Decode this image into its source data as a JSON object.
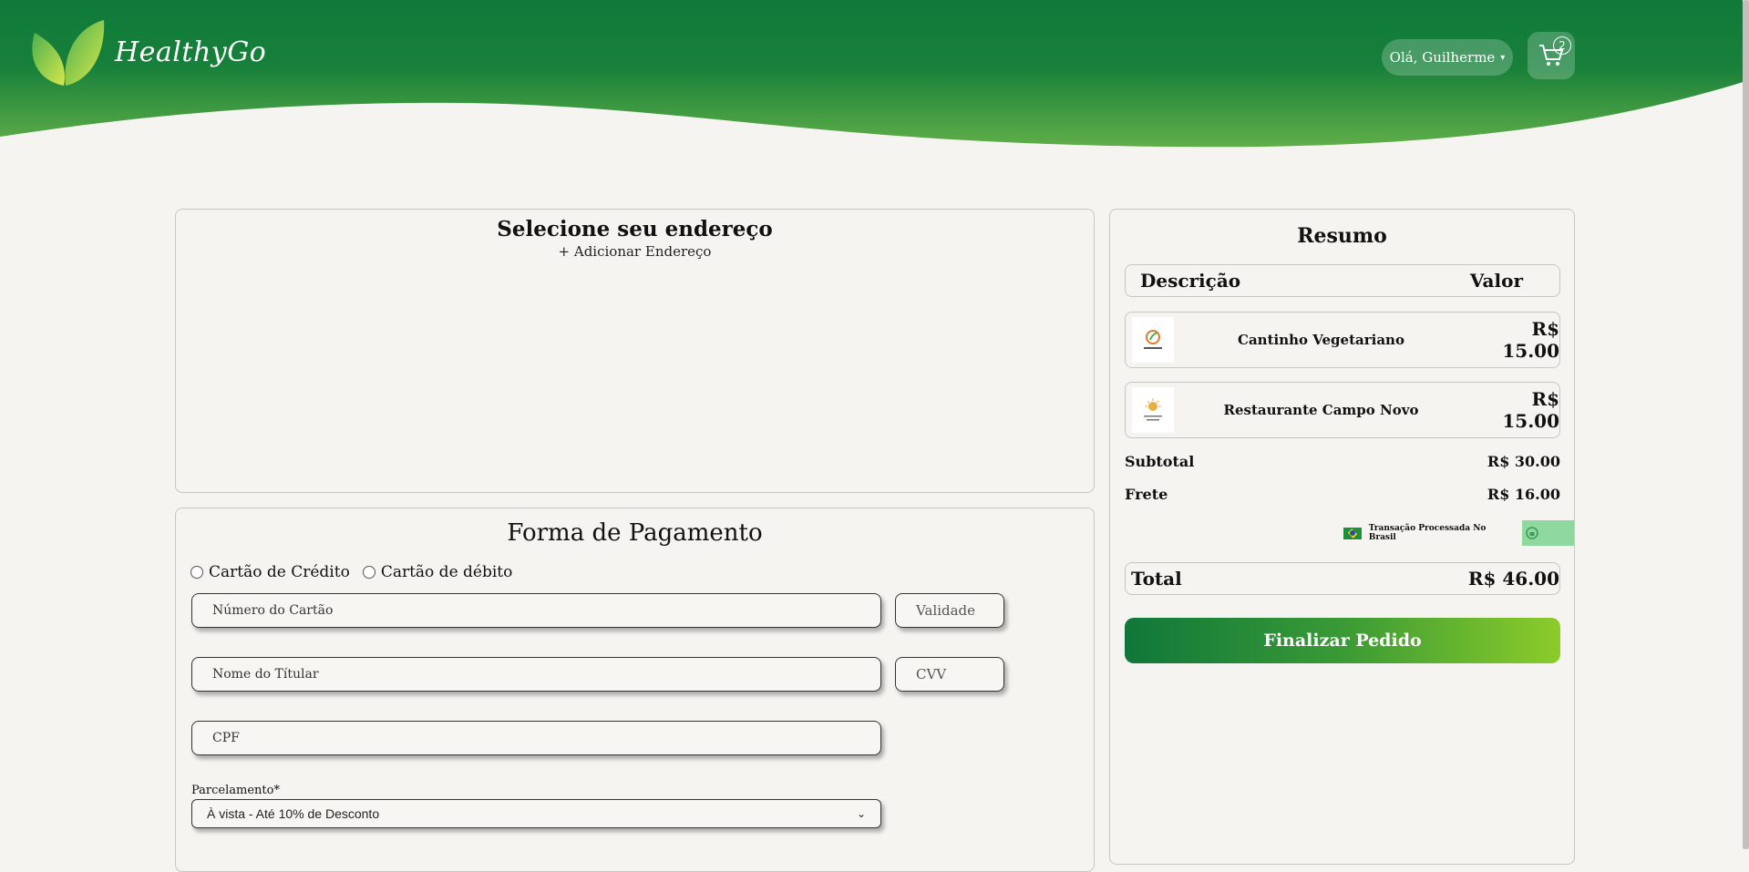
{
  "header": {
    "brand": "HealthyGo",
    "user_greeting": "Olá, Guilherme",
    "cart_count": "2"
  },
  "address": {
    "title": "Selecione seu endereço",
    "add_label": "+ Adicionar Endereço"
  },
  "payment": {
    "title": "Forma de Pagamento",
    "options": [
      "Cartão de Crédito",
      "Cartão de débito"
    ],
    "card_number_placeholder": "Número do Cartão",
    "validity_placeholder": "Validade",
    "holder_placeholder": "Nome do Títular",
    "cvv_placeholder": "CVV",
    "cpf_placeholder": "CPF",
    "installments_label": "Parcelamento*",
    "installments_value": "À vista - Até 10% de Desconto"
  },
  "summary": {
    "title": "Resumo",
    "col_description": "Descrição",
    "col_value": "Valor",
    "items": [
      {
        "name": "Cantinho Vegetariano",
        "price": "R$ 15.00"
      },
      {
        "name": "Restaurante Campo Novo",
        "price": "R$ 15.00"
      }
    ],
    "subtotal_label": "Subtotal",
    "subtotal_value": "R$ 30.00",
    "shipping_label": "Frete",
    "shipping_value": "R$ 16.00",
    "secure_text": "Transação Processada No Brasil",
    "total_label": "Total",
    "total_value": "R$ 46.00",
    "finish_label": "Finalizar Pedido"
  },
  "colors": {
    "header_dark": "#0f7a3a",
    "header_light": "#5aad47",
    "button_start": "#10773a",
    "button_end": "#8ccc2a"
  }
}
